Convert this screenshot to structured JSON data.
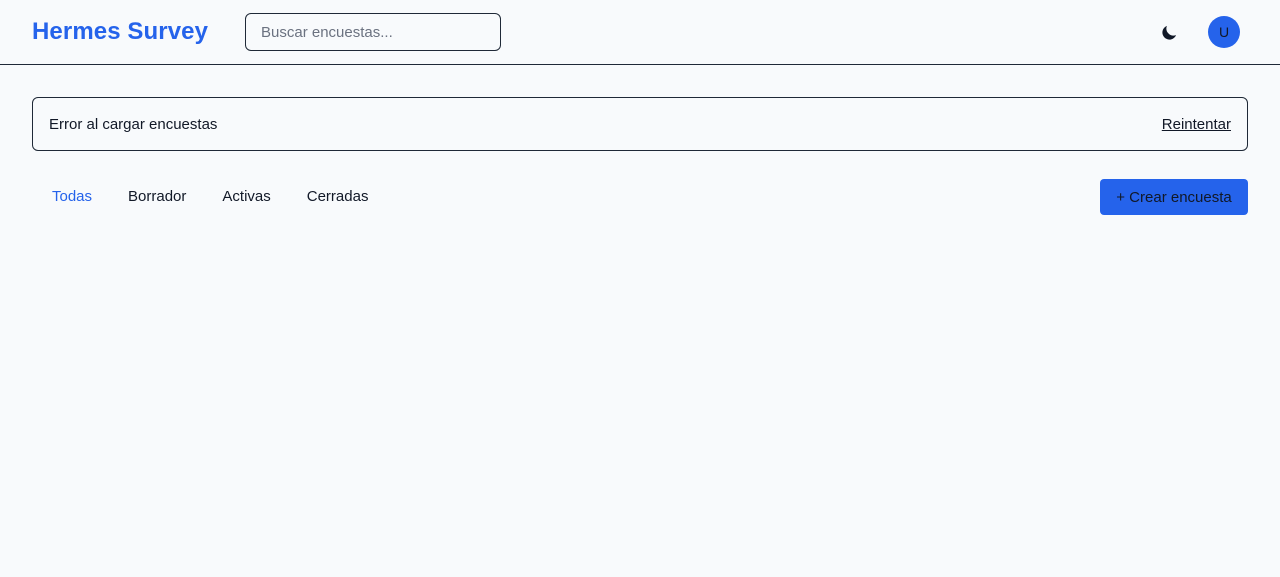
{
  "header": {
    "brand": "Hermes Survey",
    "search_placeholder": "Buscar encuestas...",
    "search_value": "",
    "theme_icon": "moon-icon",
    "avatar_initial": "U"
  },
  "alert": {
    "message": "Error al cargar encuestas",
    "retry_label": "Reintentar"
  },
  "filters": {
    "tabs": [
      {
        "label": "Todas",
        "active": true
      },
      {
        "label": "Borrador",
        "active": false
      },
      {
        "label": "Activas",
        "active": false
      },
      {
        "label": "Cerradas",
        "active": false
      }
    ],
    "create_label": "+ Crear encuesta"
  },
  "colors": {
    "accent": "#2563eb",
    "background": "#f8fafc",
    "border": "#1f2937",
    "text": "#111827"
  }
}
